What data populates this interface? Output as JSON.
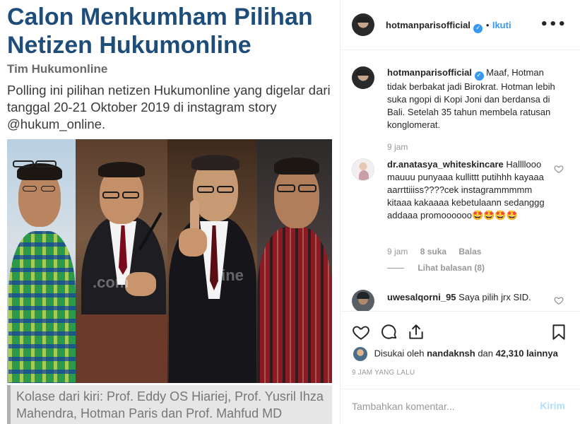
{
  "post_image": {
    "headline": "Calon Menkumham Pilihan Netizen Hukumonline",
    "byline": "Tim Hukumonline",
    "intro": "Polling ini pilihan netizen Hukumonline yang digelar dari tanggal 20-21 Oktober 2019 di instagram story @hukum_online.",
    "caption": "Kolase dari kiri: Prof. Eddy OS Hiariej, Prof. Yusril Ihza Mahendra, Hotman Paris dan Prof. Mahfud MD"
  },
  "header": {
    "username": "hotmanparisofficial",
    "verified_mark": "✓",
    "separator": "•",
    "follow_label": "Ikuti",
    "more_icon": "more-dots-icon",
    "more_glyph": "•••"
  },
  "comments": [
    {
      "username": "hotmanparisofficial",
      "verified": true,
      "text": "Maaf, Hotman tidak berbakat jadi Birokrat. Hotman lebih suka ngopi di Kopi Joni dan berdansa di Bali. Setelah 35 tahun membela ratusan konglomerat.",
      "time": "9 jam"
    },
    {
      "username": "dr.anatasya_whiteskincare",
      "text": "Hallllooo mauuu punyaaa kullittt putihhh kayaaa aarrttiiiss????cek instagrammmmm kitaaa kakaaaa kebetulaann sedanggg addaaa promoooooo🤩🤩🤩🤩",
      "time": "9 jam",
      "likes": "8 suka",
      "reply_label": "Balas",
      "view_replies": "Lihat balasan (8)"
    },
    {
      "username": "uwesalqorni_95",
      "text": "Saya pilih jrx SID."
    }
  ],
  "actions": {
    "like_icon": "heart-icon",
    "comment_icon": "comment-icon",
    "share_icon": "share-icon",
    "save_icon": "bookmark-icon",
    "liked_by_prefix": "Disukai oleh",
    "liked_by_user": "nandaknsh",
    "liked_by_joiner": "dan",
    "liked_by_others": "42,310 lainnya",
    "timestamp": "9 JAM YANG LALU"
  },
  "add_comment": {
    "placeholder": "Tambahkan komentar...",
    "send_label": "Kirim"
  },
  "colors": {
    "link_blue": "#3897f0",
    "headline_blue": "#1f4d7a",
    "muted": "#999999"
  }
}
